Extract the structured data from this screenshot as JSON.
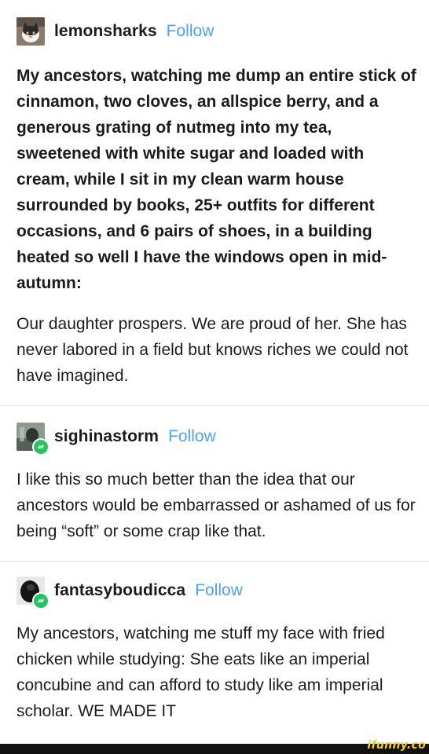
{
  "posts": [
    {
      "username": "lemonsharks",
      "follow_label": "Follow",
      "avatar": "cat-avatar",
      "bold_text": "My ancestors, watching me dump an entire stick of cinnamon, two cloves, an allspice berry, and a generous grating of nutmeg into my tea, sweetened with white sugar and loaded with cream, while I sit in my clean warm house surrounded by books, 25+ outfits for different occasions, and 6 pairs of shoes, in a building heated so well I have the windows open in mid-autumn:",
      "text": "Our daughter prospers. We are proud of her. She has never labored in a field but knows riches we could not have imagined."
    },
    {
      "username": "sighinastorm",
      "follow_label": "Follow",
      "avatar": "person-avatar",
      "badge_icon": "reblog-icon",
      "text": "I like this so much better than the idea that our ancestors would be embarrassed or ashamed of us for being “soft” or some crap like that."
    },
    {
      "username": "fantasyboudicca",
      "follow_label": "Follow",
      "avatar": "dark-avatar",
      "badge_icon": "reblog-icon",
      "text": "My ancestors, watching me stuff my face with fried chicken while studying: She eats like an imperial concubine and can afford to study like am imperial scholar. WE MADE IT"
    }
  ],
  "watermark": "ifunny.co",
  "colors": {
    "follow": "#4aa3f0",
    "badge": "#23c55f",
    "divider": "#e1e1e1"
  }
}
